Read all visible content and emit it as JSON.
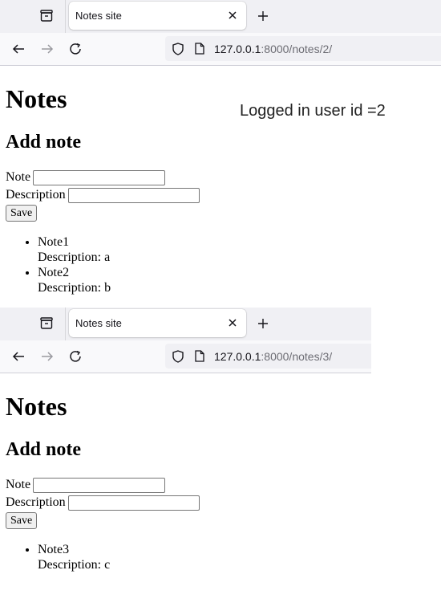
{
  "windows": [
    {
      "tab_title": "Notes site",
      "url_host": "127.0.0.1",
      "url_rest": ":8000/notes/2/",
      "heading": "Notes",
      "subheading": "Add note",
      "logged_in_text": "Logged in user id =2",
      "note_label": "Note",
      "description_label": "Description",
      "note_value": "",
      "description_value": "",
      "save_label": "Save",
      "notes": [
        {
          "title": "Note1",
          "description": "Description: a"
        },
        {
          "title": "Note2",
          "description": "Description: b"
        }
      ]
    },
    {
      "tab_title": "Notes site",
      "url_host": "127.0.0.1",
      "url_rest": ":8000/notes/3/",
      "heading": "Notes",
      "subheading": "Add note",
      "note_label": "Note",
      "description_label": "Description",
      "note_value": "",
      "description_value": "",
      "save_label": "Save",
      "notes": [
        {
          "title": "Note3",
          "description": "Description: c"
        }
      ]
    }
  ]
}
